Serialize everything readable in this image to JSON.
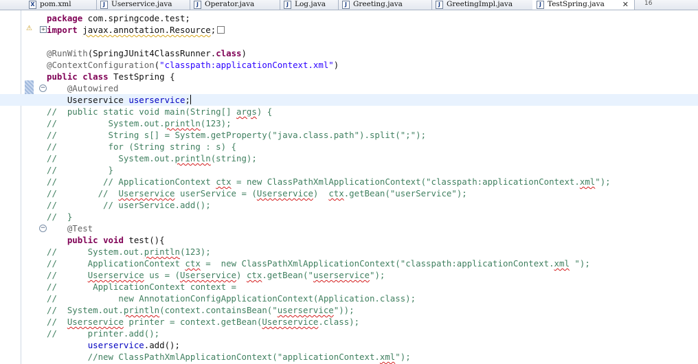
{
  "tabs": [
    {
      "label": "pom.xml",
      "icon": "X"
    },
    {
      "label": "Userservice.java",
      "icon": "J"
    },
    {
      "label": "Operator.java",
      "icon": "J"
    },
    {
      "label": "Log.java",
      "icon": "J"
    },
    {
      "label": "Greeting.java",
      "icon": "J"
    },
    {
      "label": "GreetingImpl.java",
      "icon": "J"
    },
    {
      "label": "TestSpring.java",
      "icon": "J",
      "close": "✕",
      "active": true
    }
  ],
  "overflow_count": "16",
  "gutter": {
    "warning_glyph": "⚠",
    "expand_glyph": "+",
    "fold_glyph": "−"
  },
  "colors": {
    "keyword": "#7f0055",
    "annotation": "#646464",
    "string": "#2a00ff",
    "field": "#0000c0",
    "comment": "#3f7f5f"
  },
  "lines": [
    [
      [
        "k",
        "package"
      ],
      [
        "n",
        " com.springcode.test;"
      ]
    ],
    [
      [
        "k",
        "import"
      ],
      [
        "n",
        " "
      ],
      [
        "sw",
        "javax.annotation.Resource"
      ],
      [
        "n",
        ";"
      ],
      [
        "box",
        ""
      ]
    ],
    [],
    [
      [
        "a",
        "@RunWith"
      ],
      [
        "n",
        "(SpringJUnit4ClassRunner."
      ],
      [
        "k",
        "class"
      ],
      [
        "n",
        ")"
      ]
    ],
    [
      [
        "a",
        "@ContextConfiguration"
      ],
      [
        "n",
        "("
      ],
      [
        "s",
        "\"classpath:applicationContext.xml\""
      ],
      [
        "n",
        ")"
      ]
    ],
    [
      [
        "k",
        "public"
      ],
      [
        "n",
        " "
      ],
      [
        "k",
        "class"
      ],
      [
        "n",
        " TestSpring {"
      ]
    ],
    [
      [
        "n",
        "    "
      ],
      [
        "a",
        "@Autowired"
      ]
    ],
    [
      [
        "n",
        "    Userservice "
      ],
      [
        "f",
        "userservice"
      ],
      [
        "n",
        ";"
      ],
      [
        "caret",
        ""
      ]
    ],
    [
      [
        "c",
        "//  public static void main(String[] "
      ],
      [
        "csq",
        "args"
      ],
      [
        "c",
        ") {"
      ]
    ],
    [
      [
        "c",
        "//          System.out."
      ],
      [
        "csq",
        "println"
      ],
      [
        "c",
        "(123);"
      ]
    ],
    [
      [
        "c",
        "//          String s[] = System.getProperty(\"java.class.path\").split(\";\");"
      ]
    ],
    [
      [
        "c",
        "//          for (String string : s) {"
      ]
    ],
    [
      [
        "c",
        "//            System.out."
      ],
      [
        "csq",
        "println"
      ],
      [
        "c",
        "(string);"
      ]
    ],
    [
      [
        "c",
        "//          }"
      ]
    ],
    [
      [
        "c",
        "//         // ApplicationContext "
      ],
      [
        "csq",
        "ctx"
      ],
      [
        "c",
        " = new ClassPathXmlApplicationContext(\"classpath:applicationContext."
      ],
      [
        "csq",
        "xml"
      ],
      [
        "c",
        "\");"
      ]
    ],
    [
      [
        "c",
        "//        //  "
      ],
      [
        "csq",
        "Userservice"
      ],
      [
        "c",
        " userService = ("
      ],
      [
        "csq",
        "Userservice"
      ],
      [
        "c",
        ")  "
      ],
      [
        "csq",
        "ctx"
      ],
      [
        "c",
        ".getBean(\"userService\");"
      ]
    ],
    [
      [
        "c",
        "//         // userService.add();"
      ]
    ],
    [
      [
        "c",
        "//  }"
      ]
    ],
    [
      [
        "n",
        "    "
      ],
      [
        "a",
        "@Test"
      ]
    ],
    [
      [
        "n",
        "    "
      ],
      [
        "k",
        "public"
      ],
      [
        "n",
        " "
      ],
      [
        "k",
        "void"
      ],
      [
        "n",
        " test(){"
      ]
    ],
    [
      [
        "c",
        "//      System.out."
      ],
      [
        "csq",
        "println"
      ],
      [
        "c",
        "(123);"
      ]
    ],
    [
      [
        "c",
        "//      ApplicationContext "
      ],
      [
        "csq",
        "ctx"
      ],
      [
        "c",
        " =  new ClassPathXmlApplicationContext(\"classpath:applicationContext."
      ],
      [
        "csq",
        "xml"
      ],
      [
        "c",
        " \");"
      ]
    ],
    [
      [
        "c",
        "//      "
      ],
      [
        "csq",
        "Userservice"
      ],
      [
        "c",
        " us = ("
      ],
      [
        "csq",
        "Userservice"
      ],
      [
        "c",
        ") "
      ],
      [
        "csq",
        "ctx"
      ],
      [
        "c",
        ".getBean(\""
      ],
      [
        "csq",
        "userservice"
      ],
      [
        "c",
        "\");"
      ]
    ],
    [
      [
        "c",
        "//       ApplicationContext context ="
      ]
    ],
    [
      [
        "c",
        "//            new AnnotationConfigApplicationContext(Application.class);"
      ]
    ],
    [
      [
        "c",
        "//  System.out."
      ],
      [
        "csq",
        "println"
      ],
      [
        "c",
        "(context.containsBean(\""
      ],
      [
        "csq",
        "userservice"
      ],
      [
        "c",
        "\"));"
      ]
    ],
    [
      [
        "c",
        "//  "
      ],
      [
        "csq",
        "Userservice"
      ],
      [
        "c",
        " printer = context.getBean("
      ],
      [
        "csq",
        "Userservice"
      ],
      [
        "c",
        ".class);"
      ]
    ],
    [
      [
        "c",
        "//      printer.add();"
      ]
    ],
    [
      [
        "n",
        "        "
      ],
      [
        "f",
        "userservice"
      ],
      [
        "n",
        ".add();"
      ]
    ],
    [
      [
        "c",
        "        //new ClassPathXmlApplicationContext(\"applicationContext."
      ],
      [
        "csq",
        "xml"
      ],
      [
        "c",
        "\");"
      ]
    ]
  ]
}
